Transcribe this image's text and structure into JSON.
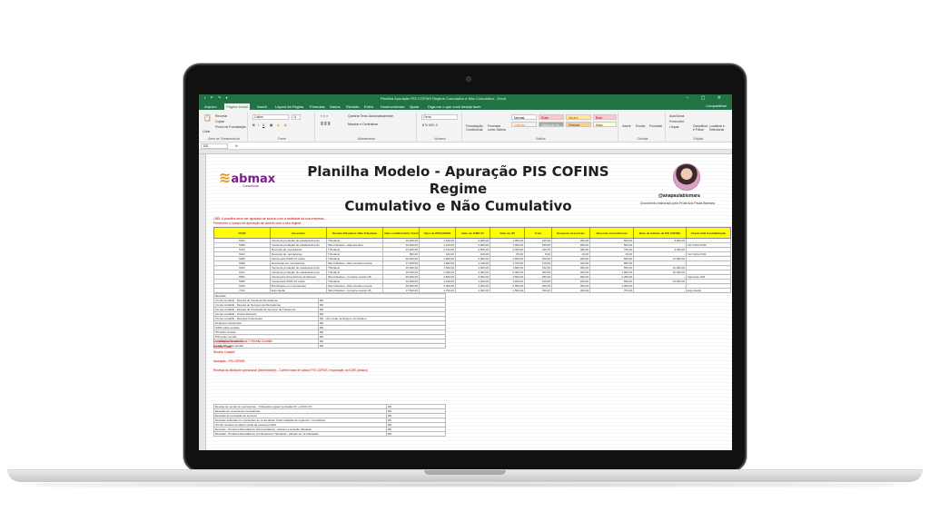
{
  "excel": {
    "window_title": "Planilha Apuração PIS COFINS Regime Cumulativo e Não Cumulativo - Excel",
    "share_label": "Compartilhar",
    "tabs": [
      "Arquivo",
      "Página Inicial",
      "Inserir",
      "Layout da Página",
      "Fórmulas",
      "Dados",
      "Revisão",
      "Exibir",
      "Desenvolvedor",
      "Ajuda",
      "Diga-me o que você deseja fazer"
    ],
    "ribbon": {
      "groups": [
        "Área de Transferência",
        "Fonte",
        "Alinhamento",
        "Número",
        "Estilos",
        "Células",
        "Edição"
      ],
      "clipboard_items": [
        "Recortar",
        "Copiar",
        "Pincel de Formatação"
      ],
      "paste_label": "Colar",
      "font_name": "Calibri",
      "font_size": "11",
      "wrap_text": "Quebrar Texto Automaticamente",
      "merge_center": "Mesclar e Centralizar",
      "number_format": "Geral",
      "cond_format": "Formatação Condicional",
      "format_table": "Formatar como Tabela",
      "styles": [
        "Normal",
        "Ruim",
        "Neutra",
        "Bom",
        "Cálculo",
        "Célula de Ve...",
        "Entrada",
        "Nota"
      ],
      "cells": [
        "Inserir",
        "Excluir",
        "Formatar"
      ],
      "editing": [
        "AutoSoma",
        "Preencher",
        "Limpar",
        "Classificar e Filtrar",
        "Localizar e Selecionar"
      ]
    },
    "name_box": "I10",
    "fx": "fx"
  },
  "sheet": {
    "logo": "abmax",
    "logo_sub": "Consultoria",
    "title_line1": "Planilha Modelo - Apuração PIS COFINS Regime",
    "title_line2": "Cumulativo e Não Cumulativo",
    "handle": "@anapaulabismara",
    "doc_note": "Documento elaborado pela Profa Ana Paula Bismara",
    "notes": [
      "OBS: A planilha deve ser ajustada de acordo com a realidade da sua empresa.",
      "Preencher o campo de apuração de acordo com o seu regime."
    ],
    "table_headers": [
      "CFOP",
      "Descrição",
      "Receita Tributável / Não Tributável",
      "Valor contábil (Valor Total NF)",
      "Valor do PIS/COFINS",
      "Valor do ICMS ST",
      "Valor do IPI",
      "Frete",
      "Despesas Acessórias",
      "Desconto Incondicional",
      "Base de Cálculo de PIS COFINS",
      "Check Unid Contabilização"
    ],
    "table_rows": [
      [
        "5101",
        "Venda de produção do estabelecimento",
        "Tributável",
        "10.000,00",
        "1.100,00",
        "2.000,00",
        "1.000,00",
        "100,00",
        "200,00",
        "500,00",
        "3.600,00",
        ""
      ],
      [
        "5405",
        "Venda de produção do estabelecimento",
        "Não tributável - Alíquota Zero",
        "10.000,00",
        "1.100,00",
        "2.000,00",
        "1.000,00",
        "100,00",
        "200,00",
        "500,00",
        "-",
        "Ver Ficha NCM"
      ],
      [
        "5102",
        "Revenda de mercadorias",
        "Tributável",
        "24.000,00",
        "2.100,00",
        "2.500,00",
        "2.400,00",
        "240,00",
        "480,00",
        "700,00",
        "3.000,00",
        ""
      ],
      [
        "5102",
        "Revenda de mercadorias",
        "Tributável",
        "800,00",
        "100,00",
        "100,00",
        "80,00",
        "8,00",
        "16,00",
        "40,00",
        "-",
        "Ver Ficha NCM"
      ],
      [
        "5405",
        "Venda para ICMS ST retido",
        "Tributável",
        "10.000,00",
        "1.000,00",
        "2.000,00",
        "1.000,00",
        "100,00",
        "200,00",
        "500,00",
        "12.000,00",
        ""
      ],
      [
        "5949",
        "Devolução em mercadorias",
        "Não tributável - Não constitui receita",
        "17.000,00",
        "1.840,00",
        "1.720,00",
        "1.700,00",
        "170,00",
        "340,00",
        "850,00",
        "-",
        ""
      ],
      [
        "5101",
        "Venda de produção do estabelecimento",
        "Tributável",
        "15.000,00",
        "1.500,00",
        "1.500,00",
        "1.500,00",
        "150,00",
        "300,00",
        "650,00",
        "12.000,00",
        ""
      ],
      [
        "5101",
        "Venda de produção do estabelecimento",
        "Tributável",
        "25.000,00",
        "2.450,00",
        "4.000,00",
        "2.000,00",
        "200,00",
        "400,00",
        "1.000,00",
        "16.000,00",
        ""
      ],
      [
        "5501",
        "Venda para Zona Franca de Manaus",
        "Não tributável - Compõe receita 1/8",
        "45.000,00",
        "4.500,00",
        "4.500,00",
        "4.500,00",
        "450,00",
        "900,00",
        "2.250,00",
        "-",
        "Ingressar 2/18"
      ],
      [
        "5405",
        "Venda para ICMS ST retido",
        "Tributável",
        "12.000,00",
        "1.140,00",
        "1.200,00",
        "1.200,00",
        "120,00",
        "240,00",
        "600,00",
        "13.000,00",
        ""
      ],
      [
        "5910",
        "Bonificação em mercadorias",
        "Não tributável - Não constitui receita",
        "20.000,00",
        "2.000,00",
        "2.000,00",
        "2.000,00",
        "200,00",
        "400,00",
        "1.000,00",
        "-",
        ""
      ],
      [
        "7101",
        "Exportação",
        "Não tributável - Compõe receita 1/8",
        "17.500,00",
        "1.750,00",
        "1.400,00",
        "1.500,00",
        "150,00",
        "300,00",
        "750,00",
        "-",
        "Exportação"
      ]
    ],
    "receitas_header": "Receitas",
    "receitas_rows": [
      [
        "(Conta contábil) - Receita de Venda de Mercadorias",
        "R$"
      ],
      [
        "(Conta contábil) - Receita de Serviços de Mercadorias",
        "R$"
      ],
      [
        "(Conta contábil) - Receita de Prestação de Serviços de Transporte",
        "R$"
      ],
      [
        "(Conta contábil) - Outras Receitas",
        "R$"
      ],
      [
        "(Conta contábil) - Receitas Financeiras",
        "R$ - não incide na Regime Cumulativo"
      ],
      [
        "Deduções da Receita",
        "R$"
      ],
      [
        "ICMS sobre vendas",
        "R$"
      ],
      [
        "IPI sobre vendas",
        "R$"
      ],
      [
        "PIS sobre vendas",
        "R$"
      ],
      [
        "COFINS sobre vendas",
        "R$"
      ],
      [
        "ICMS ST sobre vendas",
        "R$"
      ]
    ],
    "red_lines": [
      "Conciliação Receita Fiscal X Receita Contábil",
      "Receita Fiscal",
      "Receita Contábil",
      "Apuração - PIS COFINS",
      "Receitas da atividade operacional (Intermediário) - Conferir base de cálculo PIS COFINS / exportação do ICMS (abaixo)"
    ],
    "detail_rows": [
      [
        "Receita de venda de mercadorias - Tributação regular (exclusão IPI + ICMS ST)",
        "R$"
      ],
      [
        "Receitas de revenda de mercadorias",
        "R$"
      ],
      [
        "Receitas de prestação de serviços",
        "R$"
      ],
      [
        "Receitas auferidas em operações de conta alheia (intermediação de negócios / comissões)",
        "R$"
      ],
      [
        "Outras receitas do objeto social da pessoa jurídica",
        "R$"
      ],
      [
        "Receitas - Produtos Monofásicos (Intermediários) - alteram a situação tributada",
        "R$"
      ],
      [
        "Receitas - Produtos Monofásicos (combustíveis / farmácia) - alteram-se na tributação",
        "R$"
      ]
    ]
  }
}
